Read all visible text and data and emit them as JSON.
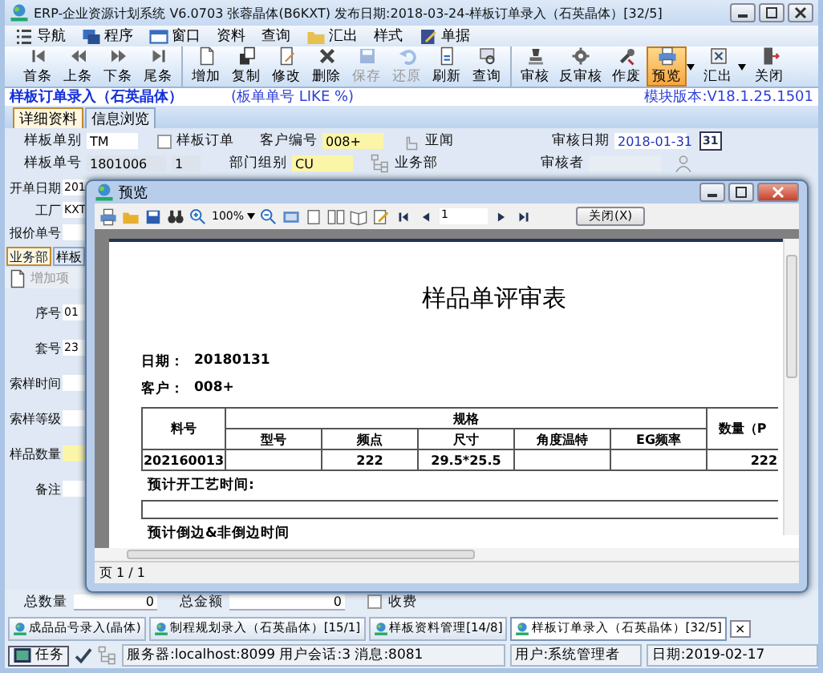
{
  "window": {
    "title": "ERP-企业资源计划系统 V6.0703 张蓉晶体(B6KXT) 发布日期:2018-03-24-样板订单录入（石英晶体）[32/5]"
  },
  "menu": [
    {
      "label": "导航"
    },
    {
      "label": "程序"
    },
    {
      "label": "窗口"
    },
    {
      "label": "资料"
    },
    {
      "label": "查询"
    },
    {
      "label": "汇出"
    },
    {
      "label": "样式"
    },
    {
      "label": "单据"
    }
  ],
  "toolbar_groups": [
    {
      "buttons": [
        {
          "label": "首条",
          "disabled": false,
          "pressed": false
        },
        {
          "label": "上条",
          "disabled": false,
          "pressed": false
        },
        {
          "label": "下条",
          "disabled": false,
          "pressed": false
        },
        {
          "label": "尾条",
          "disabled": false,
          "pressed": false
        }
      ]
    },
    {
      "buttons": [
        {
          "label": "增加",
          "disabled": false,
          "pressed": false
        },
        {
          "label": "复制",
          "disabled": false,
          "pressed": false
        },
        {
          "label": "修改",
          "disabled": false,
          "pressed": false
        },
        {
          "label": "删除",
          "disabled": false,
          "pressed": false
        },
        {
          "label": "保存",
          "disabled": true,
          "pressed": false
        },
        {
          "label": "还原",
          "disabled": true,
          "pressed": false
        },
        {
          "label": "刷新",
          "disabled": false,
          "pressed": false
        },
        {
          "label": "查询",
          "disabled": false,
          "pressed": false
        }
      ]
    },
    {
      "buttons": [
        {
          "label": "审核",
          "disabled": false,
          "pressed": false
        },
        {
          "label": "反审核",
          "disabled": false,
          "pressed": false
        },
        {
          "label": "作废",
          "disabled": false,
          "pressed": false
        },
        {
          "label": "预览",
          "disabled": false,
          "pressed": true,
          "dropdown": true
        },
        {
          "label": "汇出",
          "disabled": false,
          "pressed": false,
          "dropdown": true
        },
        {
          "label": "关闭",
          "disabled": false,
          "pressed": false
        }
      ]
    }
  ],
  "header": {
    "title": "样板订单录入（石英晶体）",
    "filter": "(板单单号 LIKE %)",
    "version": "模块版本:V18.1.25.1501"
  },
  "tabs": [
    {
      "label": "详细资料",
      "selected": true
    },
    {
      "label": "信息浏览",
      "selected": false
    }
  ],
  "form": {
    "order_type": {
      "label": "样板单别",
      "value": "TM"
    },
    "sample_order": {
      "label": "样板订单",
      "checked": false
    },
    "customer": {
      "label": "客户编号",
      "value": "008+",
      "name": "亚闻"
    },
    "audit_date": {
      "label": "审核日期",
      "value": "2018-01-31",
      "calendar": "31"
    },
    "order_no": {
      "label": "样板单号",
      "value": "1801006",
      "seq": "1"
    },
    "department": {
      "label": "部门组别",
      "value": "CU",
      "name": "业务部"
    },
    "auditor": {
      "label": "审核者"
    },
    "open_date": {
      "label": "开单日期",
      "value": "201"
    },
    "factory": {
      "label": "工厂",
      "value": "KXT"
    },
    "quote_no": {
      "label": "报价单号"
    }
  },
  "sub_tabs": [
    {
      "label": "业务部",
      "selected": true
    },
    {
      "label": "样板",
      "selected": false
    }
  ],
  "sub_toolbar": {
    "label": "增加项"
  },
  "detail_fields": [
    {
      "label": "序号",
      "value": "01",
      "required": false
    },
    {
      "label": "套号",
      "value": "23",
      "required": false
    },
    {
      "label": "索样时间",
      "required": false
    },
    {
      "label": "索样等级",
      "required": false
    },
    {
      "label": "样品数量",
      "required": true
    },
    {
      "label": "备注",
      "required": false
    }
  ],
  "totals": {
    "quantity_label": "总数量",
    "quantity": "0",
    "amount_label": "总金额",
    "amount": "0",
    "charge": {
      "label": "收费",
      "checked": false
    }
  },
  "task_tabs": [
    {
      "label": "成品品号录入(晶体)",
      "selected": false
    },
    {
      "label": "制程规划录入（石英晶体）[15/1]",
      "selected": false
    },
    {
      "label": "样板资料管理[14/8]",
      "selected": false
    },
    {
      "label": "样板订单录入（石英晶体）[32/5]",
      "selected": true,
      "close": "×"
    }
  ],
  "status_bar": {
    "task": "任务",
    "server": "服务器:localhost:8099 用户会话:3 消息:8081",
    "user": "用户:系统管理者",
    "date": "日期:2019-02-17"
  },
  "preview": {
    "title": "预览",
    "zoom": "100%",
    "page": "1",
    "close_button": "关闭(X)",
    "document": {
      "title": "样品单评审表",
      "date_label": "日期：",
      "date": "20180131",
      "customer_label": "客户：",
      "customer": "008+",
      "columns": {
        "part_no": "料号",
        "spec": "规格",
        "spec_columns": [
          "型号",
          "频点",
          "尺寸",
          "角度温特",
          "EG频率"
        ],
        "quantity": "数量（P"
      },
      "rows": [
        {
          "part_no": "202160013",
          "cells": [
            "",
            "222",
            "29.5*25.5",
            "",
            ""
          ],
          "quantity": "222"
        }
      ],
      "notes": [
        "预计开工艺时间:",
        "预计倒边&非倒边时间"
      ]
    },
    "status": "页 1 / 1"
  }
}
